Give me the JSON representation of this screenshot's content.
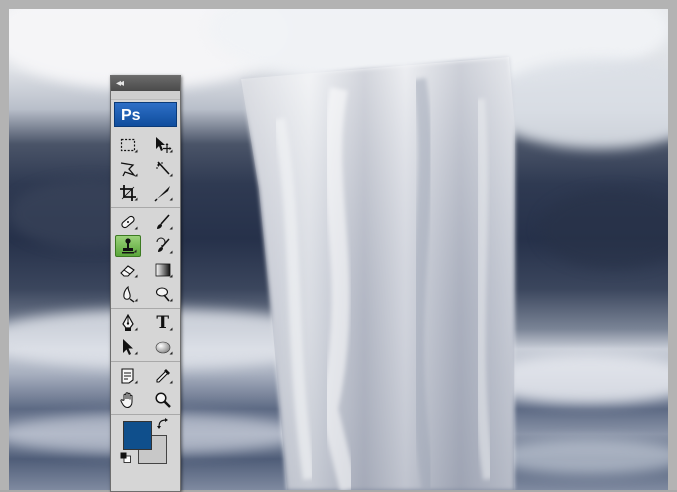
{
  "app": {
    "logo_text": "Ps"
  },
  "palette": {
    "collapse_glyph": "◂◂",
    "type_tool_glyph": "T",
    "tools": [
      [
        "rectangular-marquee-icon",
        "move-icon"
      ],
      [
        "polygonal-lasso-icon",
        "magic-wand-icon"
      ],
      [
        "crop-icon",
        "slice-icon"
      ],
      [
        "healing-brush-icon",
        "brush-icon"
      ],
      [
        "clone-stamp-icon",
        "history-brush-icon"
      ],
      [
        "eraser-icon",
        "gradient-icon"
      ],
      [
        "blur-icon",
        "dodge-icon"
      ],
      [
        "pen-icon",
        "type-icon"
      ],
      [
        "path-selection-icon",
        "ellipse-shape-icon"
      ],
      [
        "notes-icon",
        "eyedropper-icon"
      ],
      [
        "hand-icon",
        "zoom-icon"
      ]
    ],
    "active_tool": "clone-stamp-icon"
  },
  "colors": {
    "foreground": "#0f4f8c",
    "background": "#c8c8c8",
    "frame": "#b3b3b3",
    "palette_bg": "#d6d6d6",
    "active_tool": "#6fb84b"
  }
}
